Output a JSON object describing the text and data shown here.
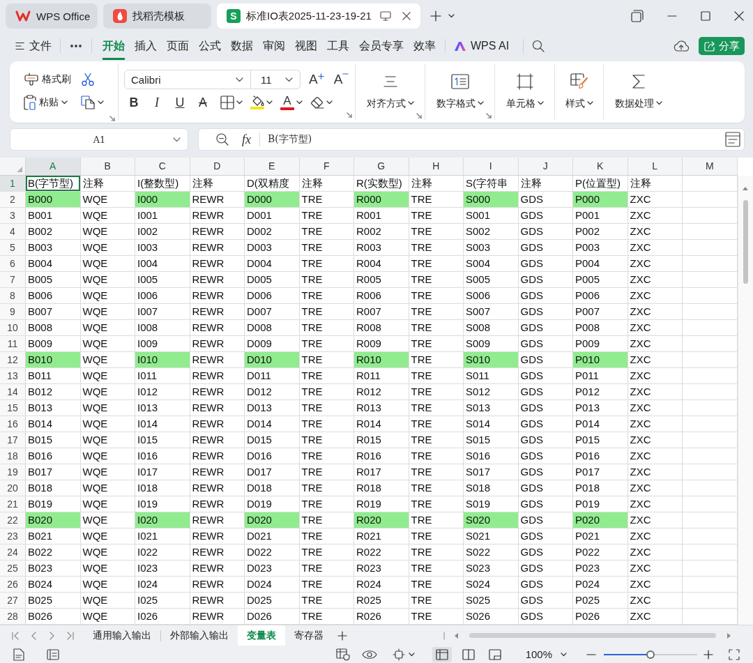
{
  "title_bar": {
    "tabs": [
      {
        "kind": "home",
        "label": "WPS Office",
        "selected": false
      },
      {
        "kind": "template",
        "label": "找稻壳模板",
        "selected": false
      },
      {
        "kind": "sheet",
        "badge": "S",
        "label": "标准IO表2025-11-23-19-21",
        "selected": true
      }
    ]
  },
  "menu_bar": {
    "file": {
      "label": "文件"
    },
    "tabs": [
      {
        "label": "开始",
        "selected": true
      },
      {
        "label": "插入",
        "selected": false
      },
      {
        "label": "页面",
        "selected": false
      },
      {
        "label": "公式",
        "selected": false
      },
      {
        "label": "数据",
        "selected": false
      },
      {
        "label": "审阅",
        "selected": false
      },
      {
        "label": "视图",
        "selected": false
      },
      {
        "label": "工具",
        "selected": false
      },
      {
        "label": "会员专享",
        "selected": false
      },
      {
        "label": "效率",
        "selected": false
      }
    ],
    "ai": {
      "label": "WPS AI"
    },
    "share": {
      "label": "分享"
    }
  },
  "ribbon": {
    "format_painter": {
      "label": "格式刷"
    },
    "paste": {
      "label": "粘贴"
    },
    "font_name": "Calibri",
    "font_size": "11",
    "size_buttons": [
      {
        "kind": "grow",
        "glyph": "A"
      },
      {
        "kind": "shrink",
        "glyph": "A"
      }
    ],
    "style_buttons": [
      {
        "kind": "bold",
        "glyph": "B"
      },
      {
        "kind": "italic",
        "glyph": "I"
      },
      {
        "kind": "underline",
        "glyph": "U"
      },
      {
        "kind": "strikethrough",
        "glyph": "A"
      }
    ],
    "color_buttons": [
      {
        "kind": "fill",
        "color": "#f4e61c"
      },
      {
        "kind": "font",
        "glyph": "A",
        "color": "#e3161e"
      }
    ],
    "groups": [
      {
        "kind": "align",
        "label": "对齐方式",
        "launcher": true
      },
      {
        "kind": "number",
        "label": "数字格式",
        "launcher": true
      },
      {
        "kind": "cells",
        "label": "单元格",
        "launcher": false
      },
      {
        "kind": "style",
        "label": "样式",
        "launcher": false
      },
      {
        "kind": "data",
        "label": "数据处理",
        "launcher": false
      }
    ]
  },
  "formula_bar": {
    "cell": "A1",
    "function_label": "fx",
    "formula": "B(字节型)"
  },
  "sheet": {
    "columns": [
      {
        "label": "A",
        "selected": true
      },
      {
        "label": "B",
        "selected": false
      },
      {
        "label": "C",
        "selected": false
      },
      {
        "label": "D",
        "selected": false
      },
      {
        "label": "E",
        "selected": false
      },
      {
        "label": "F",
        "selected": false
      },
      {
        "label": "G",
        "selected": false
      },
      {
        "label": "H",
        "selected": false
      },
      {
        "label": "I",
        "selected": false
      },
      {
        "label": "J",
        "selected": false
      },
      {
        "label": "K",
        "selected": false
      },
      {
        "label": "L",
        "selected": false
      },
      {
        "label": "M",
        "selected": false
      }
    ],
    "rows": [
      {
        "number": "1",
        "selected": true,
        "cells": [
          {
            "text": "B(字节型)",
            "highlighted": false
          },
          {
            "text": "注释",
            "highlighted": false
          },
          {
            "text": "I(整数型)",
            "highlighted": false
          },
          {
            "text": "注释",
            "highlighted": false
          },
          {
            "text": "D(双精度",
            "highlighted": false
          },
          {
            "text": "注释",
            "highlighted": false
          },
          {
            "text": "R(实数型)",
            "highlighted": false
          },
          {
            "text": "注释",
            "highlighted": false
          },
          {
            "text": "S(字符串",
            "highlighted": false
          },
          {
            "text": "注释",
            "highlighted": false
          },
          {
            "text": "P(位置型)",
            "highlighted": false
          },
          {
            "text": "注释",
            "highlighted": false
          }
        ]
      },
      {
        "number": "2",
        "selected": false,
        "cells": [
          {
            "text": "B000",
            "highlighted": true
          },
          {
            "text": "WQE",
            "highlighted": false
          },
          {
            "text": "I000",
            "highlighted": true
          },
          {
            "text": "REWR",
            "highlighted": false
          },
          {
            "text": "D000",
            "highlighted": true
          },
          {
            "text": "TRE",
            "highlighted": false
          },
          {
            "text": "R000",
            "highlighted": true
          },
          {
            "text": "TRE",
            "highlighted": false
          },
          {
            "text": "S000",
            "highlighted": true
          },
          {
            "text": "GDS",
            "highlighted": false
          },
          {
            "text": "P000",
            "highlighted": true
          },
          {
            "text": "ZXC",
            "highlighted": false
          }
        ]
      },
      {
        "number": "3",
        "selected": false,
        "cells": [
          {
            "text": "B001",
            "highlighted": false
          },
          {
            "text": "WQE",
            "highlighted": false
          },
          {
            "text": "I001",
            "highlighted": false
          },
          {
            "text": "REWR",
            "highlighted": false
          },
          {
            "text": "D001",
            "highlighted": false
          },
          {
            "text": "TRE",
            "highlighted": false
          },
          {
            "text": "R001",
            "highlighted": false
          },
          {
            "text": "TRE",
            "highlighted": false
          },
          {
            "text": "S001",
            "highlighted": false
          },
          {
            "text": "GDS",
            "highlighted": false
          },
          {
            "text": "P001",
            "highlighted": false
          },
          {
            "text": "ZXC",
            "highlighted": false
          }
        ]
      },
      {
        "number": "4",
        "selected": false,
        "cells": [
          {
            "text": "B002",
            "highlighted": false
          },
          {
            "text": "WQE",
            "highlighted": false
          },
          {
            "text": "I002",
            "highlighted": false
          },
          {
            "text": "REWR",
            "highlighted": false
          },
          {
            "text": "D002",
            "highlighted": false
          },
          {
            "text": "TRE",
            "highlighted": false
          },
          {
            "text": "R002",
            "highlighted": false
          },
          {
            "text": "TRE",
            "highlighted": false
          },
          {
            "text": "S002",
            "highlighted": false
          },
          {
            "text": "GDS",
            "highlighted": false
          },
          {
            "text": "P002",
            "highlighted": false
          },
          {
            "text": "ZXC",
            "highlighted": false
          }
        ]
      },
      {
        "number": "5",
        "selected": false,
        "cells": [
          {
            "text": "B003",
            "highlighted": false
          },
          {
            "text": "WQE",
            "highlighted": false
          },
          {
            "text": "I003",
            "highlighted": false
          },
          {
            "text": "REWR",
            "highlighted": false
          },
          {
            "text": "D003",
            "highlighted": false
          },
          {
            "text": "TRE",
            "highlighted": false
          },
          {
            "text": "R003",
            "highlighted": false
          },
          {
            "text": "TRE",
            "highlighted": false
          },
          {
            "text": "S003",
            "highlighted": false
          },
          {
            "text": "GDS",
            "highlighted": false
          },
          {
            "text": "P003",
            "highlighted": false
          },
          {
            "text": "ZXC",
            "highlighted": false
          }
        ]
      },
      {
        "number": "6",
        "selected": false,
        "cells": [
          {
            "text": "B004",
            "highlighted": false
          },
          {
            "text": "WQE",
            "highlighted": false
          },
          {
            "text": "I004",
            "highlighted": false
          },
          {
            "text": "REWR",
            "highlighted": false
          },
          {
            "text": "D004",
            "highlighted": false
          },
          {
            "text": "TRE",
            "highlighted": false
          },
          {
            "text": "R004",
            "highlighted": false
          },
          {
            "text": "TRE",
            "highlighted": false
          },
          {
            "text": "S004",
            "highlighted": false
          },
          {
            "text": "GDS",
            "highlighted": false
          },
          {
            "text": "P004",
            "highlighted": false
          },
          {
            "text": "ZXC",
            "highlighted": false
          }
        ]
      },
      {
        "number": "7",
        "selected": false,
        "cells": [
          {
            "text": "B005",
            "highlighted": false
          },
          {
            "text": "WQE",
            "highlighted": false
          },
          {
            "text": "I005",
            "highlighted": false
          },
          {
            "text": "REWR",
            "highlighted": false
          },
          {
            "text": "D005",
            "highlighted": false
          },
          {
            "text": "TRE",
            "highlighted": false
          },
          {
            "text": "R005",
            "highlighted": false
          },
          {
            "text": "TRE",
            "highlighted": false
          },
          {
            "text": "S005",
            "highlighted": false
          },
          {
            "text": "GDS",
            "highlighted": false
          },
          {
            "text": "P005",
            "highlighted": false
          },
          {
            "text": "ZXC",
            "highlighted": false
          }
        ]
      },
      {
        "number": "8",
        "selected": false,
        "cells": [
          {
            "text": "B006",
            "highlighted": false
          },
          {
            "text": "WQE",
            "highlighted": false
          },
          {
            "text": "I006",
            "highlighted": false
          },
          {
            "text": "REWR",
            "highlighted": false
          },
          {
            "text": "D006",
            "highlighted": false
          },
          {
            "text": "TRE",
            "highlighted": false
          },
          {
            "text": "R006",
            "highlighted": false
          },
          {
            "text": "TRE",
            "highlighted": false
          },
          {
            "text": "S006",
            "highlighted": false
          },
          {
            "text": "GDS",
            "highlighted": false
          },
          {
            "text": "P006",
            "highlighted": false
          },
          {
            "text": "ZXC",
            "highlighted": false
          }
        ]
      },
      {
        "number": "9",
        "selected": false,
        "cells": [
          {
            "text": "B007",
            "highlighted": false
          },
          {
            "text": "WQE",
            "highlighted": false
          },
          {
            "text": "I007",
            "highlighted": false
          },
          {
            "text": "REWR",
            "highlighted": false
          },
          {
            "text": "D007",
            "highlighted": false
          },
          {
            "text": "TRE",
            "highlighted": false
          },
          {
            "text": "R007",
            "highlighted": false
          },
          {
            "text": "TRE",
            "highlighted": false
          },
          {
            "text": "S007",
            "highlighted": false
          },
          {
            "text": "GDS",
            "highlighted": false
          },
          {
            "text": "P007",
            "highlighted": false
          },
          {
            "text": "ZXC",
            "highlighted": false
          }
        ]
      },
      {
        "number": "10",
        "selected": false,
        "cells": [
          {
            "text": "B008",
            "highlighted": false
          },
          {
            "text": "WQE",
            "highlighted": false
          },
          {
            "text": "I008",
            "highlighted": false
          },
          {
            "text": "REWR",
            "highlighted": false
          },
          {
            "text": "D008",
            "highlighted": false
          },
          {
            "text": "TRE",
            "highlighted": false
          },
          {
            "text": "R008",
            "highlighted": false
          },
          {
            "text": "TRE",
            "highlighted": false
          },
          {
            "text": "S008",
            "highlighted": false
          },
          {
            "text": "GDS",
            "highlighted": false
          },
          {
            "text": "P008",
            "highlighted": false
          },
          {
            "text": "ZXC",
            "highlighted": false
          }
        ]
      },
      {
        "number": "11",
        "selected": false,
        "cells": [
          {
            "text": "B009",
            "highlighted": false
          },
          {
            "text": "WQE",
            "highlighted": false
          },
          {
            "text": "I009",
            "highlighted": false
          },
          {
            "text": "REWR",
            "highlighted": false
          },
          {
            "text": "D009",
            "highlighted": false
          },
          {
            "text": "TRE",
            "highlighted": false
          },
          {
            "text": "R009",
            "highlighted": false
          },
          {
            "text": "TRE",
            "highlighted": false
          },
          {
            "text": "S009",
            "highlighted": false
          },
          {
            "text": "GDS",
            "highlighted": false
          },
          {
            "text": "P009",
            "highlighted": false
          },
          {
            "text": "ZXC",
            "highlighted": false
          }
        ]
      },
      {
        "number": "12",
        "selected": false,
        "cells": [
          {
            "text": "B010",
            "highlighted": true
          },
          {
            "text": "WQE",
            "highlighted": false
          },
          {
            "text": "I010",
            "highlighted": true
          },
          {
            "text": "REWR",
            "highlighted": false
          },
          {
            "text": "D010",
            "highlighted": true
          },
          {
            "text": "TRE",
            "highlighted": false
          },
          {
            "text": "R010",
            "highlighted": true
          },
          {
            "text": "TRE",
            "highlighted": false
          },
          {
            "text": "S010",
            "highlighted": true
          },
          {
            "text": "GDS",
            "highlighted": false
          },
          {
            "text": "P010",
            "highlighted": true
          },
          {
            "text": "ZXC",
            "highlighted": false
          }
        ]
      },
      {
        "number": "13",
        "selected": false,
        "cells": [
          {
            "text": "B011",
            "highlighted": false
          },
          {
            "text": "WQE",
            "highlighted": false
          },
          {
            "text": "I011",
            "highlighted": false
          },
          {
            "text": "REWR",
            "highlighted": false
          },
          {
            "text": "D011",
            "highlighted": false
          },
          {
            "text": "TRE",
            "highlighted": false
          },
          {
            "text": "R011",
            "highlighted": false
          },
          {
            "text": "TRE",
            "highlighted": false
          },
          {
            "text": "S011",
            "highlighted": false
          },
          {
            "text": "GDS",
            "highlighted": false
          },
          {
            "text": "P011",
            "highlighted": false
          },
          {
            "text": "ZXC",
            "highlighted": false
          }
        ]
      },
      {
        "number": "14",
        "selected": false,
        "cells": [
          {
            "text": "B012",
            "highlighted": false
          },
          {
            "text": "WQE",
            "highlighted": false
          },
          {
            "text": "I012",
            "highlighted": false
          },
          {
            "text": "REWR",
            "highlighted": false
          },
          {
            "text": "D012",
            "highlighted": false
          },
          {
            "text": "TRE",
            "highlighted": false
          },
          {
            "text": "R012",
            "highlighted": false
          },
          {
            "text": "TRE",
            "highlighted": false
          },
          {
            "text": "S012",
            "highlighted": false
          },
          {
            "text": "GDS",
            "highlighted": false
          },
          {
            "text": "P012",
            "highlighted": false
          },
          {
            "text": "ZXC",
            "highlighted": false
          }
        ]
      },
      {
        "number": "15",
        "selected": false,
        "cells": [
          {
            "text": "B013",
            "highlighted": false
          },
          {
            "text": "WQE",
            "highlighted": false
          },
          {
            "text": "I013",
            "highlighted": false
          },
          {
            "text": "REWR",
            "highlighted": false
          },
          {
            "text": "D013",
            "highlighted": false
          },
          {
            "text": "TRE",
            "highlighted": false
          },
          {
            "text": "R013",
            "highlighted": false
          },
          {
            "text": "TRE",
            "highlighted": false
          },
          {
            "text": "S013",
            "highlighted": false
          },
          {
            "text": "GDS",
            "highlighted": false
          },
          {
            "text": "P013",
            "highlighted": false
          },
          {
            "text": "ZXC",
            "highlighted": false
          }
        ]
      },
      {
        "number": "16",
        "selected": false,
        "cells": [
          {
            "text": "B014",
            "highlighted": false
          },
          {
            "text": "WQE",
            "highlighted": false
          },
          {
            "text": "I014",
            "highlighted": false
          },
          {
            "text": "REWR",
            "highlighted": false
          },
          {
            "text": "D014",
            "highlighted": false
          },
          {
            "text": "TRE",
            "highlighted": false
          },
          {
            "text": "R014",
            "highlighted": false
          },
          {
            "text": "TRE",
            "highlighted": false
          },
          {
            "text": "S014",
            "highlighted": false
          },
          {
            "text": "GDS",
            "highlighted": false
          },
          {
            "text": "P014",
            "highlighted": false
          },
          {
            "text": "ZXC",
            "highlighted": false
          }
        ]
      },
      {
        "number": "17",
        "selected": false,
        "cells": [
          {
            "text": "B015",
            "highlighted": false
          },
          {
            "text": "WQE",
            "highlighted": false
          },
          {
            "text": "I015",
            "highlighted": false
          },
          {
            "text": "REWR",
            "highlighted": false
          },
          {
            "text": "D015",
            "highlighted": false
          },
          {
            "text": "TRE",
            "highlighted": false
          },
          {
            "text": "R015",
            "highlighted": false
          },
          {
            "text": "TRE",
            "highlighted": false
          },
          {
            "text": "S015",
            "highlighted": false
          },
          {
            "text": "GDS",
            "highlighted": false
          },
          {
            "text": "P015",
            "highlighted": false
          },
          {
            "text": "ZXC",
            "highlighted": false
          }
        ]
      },
      {
        "number": "18",
        "selected": false,
        "cells": [
          {
            "text": "B016",
            "highlighted": false
          },
          {
            "text": "WQE",
            "highlighted": false
          },
          {
            "text": "I016",
            "highlighted": false
          },
          {
            "text": "REWR",
            "highlighted": false
          },
          {
            "text": "D016",
            "highlighted": false
          },
          {
            "text": "TRE",
            "highlighted": false
          },
          {
            "text": "R016",
            "highlighted": false
          },
          {
            "text": "TRE",
            "highlighted": false
          },
          {
            "text": "S016",
            "highlighted": false
          },
          {
            "text": "GDS",
            "highlighted": false
          },
          {
            "text": "P016",
            "highlighted": false
          },
          {
            "text": "ZXC",
            "highlighted": false
          }
        ]
      },
      {
        "number": "19",
        "selected": false,
        "cells": [
          {
            "text": "B017",
            "highlighted": false
          },
          {
            "text": "WQE",
            "highlighted": false
          },
          {
            "text": "I017",
            "highlighted": false
          },
          {
            "text": "REWR",
            "highlighted": false
          },
          {
            "text": "D017",
            "highlighted": false
          },
          {
            "text": "TRE",
            "highlighted": false
          },
          {
            "text": "R017",
            "highlighted": false
          },
          {
            "text": "TRE",
            "highlighted": false
          },
          {
            "text": "S017",
            "highlighted": false
          },
          {
            "text": "GDS",
            "highlighted": false
          },
          {
            "text": "P017",
            "highlighted": false
          },
          {
            "text": "ZXC",
            "highlighted": false
          }
        ]
      },
      {
        "number": "20",
        "selected": false,
        "cells": [
          {
            "text": "B018",
            "highlighted": false
          },
          {
            "text": "WQE",
            "highlighted": false
          },
          {
            "text": "I018",
            "highlighted": false
          },
          {
            "text": "REWR",
            "highlighted": false
          },
          {
            "text": "D018",
            "highlighted": false
          },
          {
            "text": "TRE",
            "highlighted": false
          },
          {
            "text": "R018",
            "highlighted": false
          },
          {
            "text": "TRE",
            "highlighted": false
          },
          {
            "text": "S018",
            "highlighted": false
          },
          {
            "text": "GDS",
            "highlighted": false
          },
          {
            "text": "P018",
            "highlighted": false
          },
          {
            "text": "ZXC",
            "highlighted": false
          }
        ]
      },
      {
        "number": "21",
        "selected": false,
        "cells": [
          {
            "text": "B019",
            "highlighted": false
          },
          {
            "text": "WQE",
            "highlighted": false
          },
          {
            "text": "I019",
            "highlighted": false
          },
          {
            "text": "REWR",
            "highlighted": false
          },
          {
            "text": "D019",
            "highlighted": false
          },
          {
            "text": "TRE",
            "highlighted": false
          },
          {
            "text": "R019",
            "highlighted": false
          },
          {
            "text": "TRE",
            "highlighted": false
          },
          {
            "text": "S019",
            "highlighted": false
          },
          {
            "text": "GDS",
            "highlighted": false
          },
          {
            "text": "P019",
            "highlighted": false
          },
          {
            "text": "ZXC",
            "highlighted": false
          }
        ]
      },
      {
        "number": "22",
        "selected": false,
        "cells": [
          {
            "text": "B020",
            "highlighted": true
          },
          {
            "text": "WQE",
            "highlighted": false
          },
          {
            "text": "I020",
            "highlighted": true
          },
          {
            "text": "REWR",
            "highlighted": false
          },
          {
            "text": "D020",
            "highlighted": true
          },
          {
            "text": "TRE",
            "highlighted": false
          },
          {
            "text": "R020",
            "highlighted": true
          },
          {
            "text": "TRE",
            "highlighted": false
          },
          {
            "text": "S020",
            "highlighted": true
          },
          {
            "text": "GDS",
            "highlighted": false
          },
          {
            "text": "P020",
            "highlighted": true
          },
          {
            "text": "ZXC",
            "highlighted": false
          }
        ]
      },
      {
        "number": "23",
        "selected": false,
        "cells": [
          {
            "text": "B021",
            "highlighted": false
          },
          {
            "text": "WQE",
            "highlighted": false
          },
          {
            "text": "I021",
            "highlighted": false
          },
          {
            "text": "REWR",
            "highlighted": false
          },
          {
            "text": "D021",
            "highlighted": false
          },
          {
            "text": "TRE",
            "highlighted": false
          },
          {
            "text": "R021",
            "highlighted": false
          },
          {
            "text": "TRE",
            "highlighted": false
          },
          {
            "text": "S021",
            "highlighted": false
          },
          {
            "text": "GDS",
            "highlighted": false
          },
          {
            "text": "P021",
            "highlighted": false
          },
          {
            "text": "ZXC",
            "highlighted": false
          }
        ]
      },
      {
        "number": "24",
        "selected": false,
        "cells": [
          {
            "text": "B022",
            "highlighted": false
          },
          {
            "text": "WQE",
            "highlighted": false
          },
          {
            "text": "I022",
            "highlighted": false
          },
          {
            "text": "REWR",
            "highlighted": false
          },
          {
            "text": "D022",
            "highlighted": false
          },
          {
            "text": "TRE",
            "highlighted": false
          },
          {
            "text": "R022",
            "highlighted": false
          },
          {
            "text": "TRE",
            "highlighted": false
          },
          {
            "text": "S022",
            "highlighted": false
          },
          {
            "text": "GDS",
            "highlighted": false
          },
          {
            "text": "P022",
            "highlighted": false
          },
          {
            "text": "ZXC",
            "highlighted": false
          }
        ]
      },
      {
        "number": "25",
        "selected": false,
        "cells": [
          {
            "text": "B023",
            "highlighted": false
          },
          {
            "text": "WQE",
            "highlighted": false
          },
          {
            "text": "I023",
            "highlighted": false
          },
          {
            "text": "REWR",
            "highlighted": false
          },
          {
            "text": "D023",
            "highlighted": false
          },
          {
            "text": "TRE",
            "highlighted": false
          },
          {
            "text": "R023",
            "highlighted": false
          },
          {
            "text": "TRE",
            "highlighted": false
          },
          {
            "text": "S023",
            "highlighted": false
          },
          {
            "text": "GDS",
            "highlighted": false
          },
          {
            "text": "P023",
            "highlighted": false
          },
          {
            "text": "ZXC",
            "highlighted": false
          }
        ]
      },
      {
        "number": "26",
        "selected": false,
        "cells": [
          {
            "text": "B024",
            "highlighted": false
          },
          {
            "text": "WQE",
            "highlighted": false
          },
          {
            "text": "I024",
            "highlighted": false
          },
          {
            "text": "REWR",
            "highlighted": false
          },
          {
            "text": "D024",
            "highlighted": false
          },
          {
            "text": "TRE",
            "highlighted": false
          },
          {
            "text": "R024",
            "highlighted": false
          },
          {
            "text": "TRE",
            "highlighted": false
          },
          {
            "text": "S024",
            "highlighted": false
          },
          {
            "text": "GDS",
            "highlighted": false
          },
          {
            "text": "P024",
            "highlighted": false
          },
          {
            "text": "ZXC",
            "highlighted": false
          }
        ]
      },
      {
        "number": "27",
        "selected": false,
        "cells": [
          {
            "text": "B025",
            "highlighted": false
          },
          {
            "text": "WQE",
            "highlighted": false
          },
          {
            "text": "I025",
            "highlighted": false
          },
          {
            "text": "REWR",
            "highlighted": false
          },
          {
            "text": "D025",
            "highlighted": false
          },
          {
            "text": "TRE",
            "highlighted": false
          },
          {
            "text": "R025",
            "highlighted": false
          },
          {
            "text": "TRE",
            "highlighted": false
          },
          {
            "text": "S025",
            "highlighted": false
          },
          {
            "text": "GDS",
            "highlighted": false
          },
          {
            "text": "P025",
            "highlighted": false
          },
          {
            "text": "ZXC",
            "highlighted": false
          }
        ]
      },
      {
        "number": "28",
        "selected": false,
        "cells": [
          {
            "text": "B026",
            "highlighted": false
          },
          {
            "text": "WQE",
            "highlighted": false
          },
          {
            "text": "I026",
            "highlighted": false
          },
          {
            "text": "REWR",
            "highlighted": false
          },
          {
            "text": "D026",
            "highlighted": false
          },
          {
            "text": "TRE",
            "highlighted": false
          },
          {
            "text": "R026",
            "highlighted": false
          },
          {
            "text": "TRE",
            "highlighted": false
          },
          {
            "text": "S026",
            "highlighted": false
          },
          {
            "text": "GDS",
            "highlighted": false
          },
          {
            "text": "P026",
            "highlighted": false
          },
          {
            "text": "ZXC",
            "highlighted": false
          }
        ]
      }
    ]
  },
  "sheet_tabs": [
    {
      "label": "通用输入输出",
      "selected": false
    },
    {
      "label": "外部输入输出",
      "selected": false
    },
    {
      "label": "变量表",
      "selected": true
    },
    {
      "label": "寄存器",
      "selected": false
    }
  ],
  "status_bar": {
    "views": [
      {
        "kind": "normal",
        "selected": true
      },
      {
        "kind": "page_break",
        "selected": false
      },
      {
        "kind": "reading",
        "selected": false
      }
    ],
    "zoom": "100%",
    "zoom_slider": {
      "level": 0.5
    }
  }
}
